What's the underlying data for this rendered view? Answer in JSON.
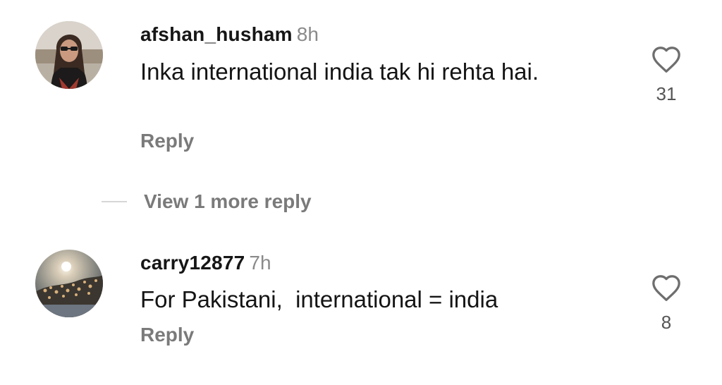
{
  "comments": [
    {
      "username": "afshan_husham",
      "time": "8h",
      "text": "Inka international india tak hi rehta hai.",
      "reply_label": "Reply",
      "likes": "31",
      "avatar_icon": "profile-photo-woman-icon"
    },
    {
      "username": "carry12877",
      "time": "7h",
      "text": "For Pakistani,  international = india",
      "reply_label": "Reply",
      "likes": "8",
      "avatar_icon": "profile-photo-sunset-blossom-icon"
    }
  ],
  "view_more": {
    "label": "View 1 more reply"
  },
  "icons": {
    "like": "heart-outline-icon"
  },
  "colors": {
    "username": "#161616",
    "secondary": "#7a7a7a",
    "timestamp": "#8a8a8a",
    "divider": "#d6d6d6"
  }
}
